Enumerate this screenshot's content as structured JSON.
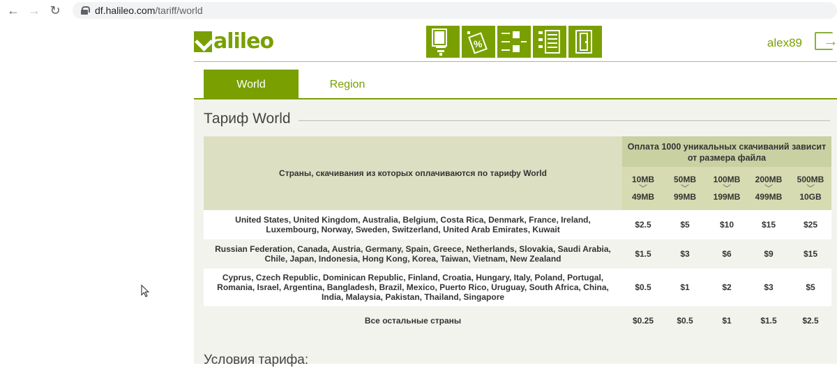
{
  "browser": {
    "url_host": "df.halileo.com",
    "url_path": "/tariff/world",
    "nav_icons": [
      "back-arrow-icon",
      "forward-arrow-icon",
      "reload-icon",
      "lock-icon"
    ]
  },
  "header": {
    "logo_text": "alileo",
    "logo_icon": "halileo-logo-icon",
    "username": "alex89",
    "tool_icons": [
      "document-download-icon",
      "percent-tag-icon",
      "flow-arrows-icon",
      "list-document-icon",
      "door-icon"
    ]
  },
  "tabs": [
    {
      "label": "World",
      "active": true
    },
    {
      "label": "Region",
      "active": false
    }
  ],
  "page_title": "Тариф World",
  "table": {
    "header_countries": "Страны, скачивания из которых оплачиваются по тарифу World",
    "header_payment": "Оплата 1000 уникальных скачиваний зависит от размера файла",
    "sizes": [
      {
        "from": "10MB",
        "to": "49MB"
      },
      {
        "from": "50MB",
        "to": "99MB"
      },
      {
        "from": "100MB",
        "to": "199MB"
      },
      {
        "from": "200MB",
        "to": "499MB"
      },
      {
        "from": "500MB",
        "to": "10GB"
      }
    ],
    "rows": [
      {
        "countries": "United States, United Kingdom, Australia, Belgium, Costa Rica, Denmark, France, Ireland, Luxembourg, Norway, Sweden, Switzerland, United Arab Emirates, Kuwait",
        "prices": [
          "$2.5",
          "$5",
          "$10",
          "$15",
          "$25"
        ]
      },
      {
        "countries": "Russian Federation, Canada, Austria, Germany, Spain, Greece, Netherlands, Slovakia, Saudi Arabia, Chile, Japan, Indonesia, Hong Kong, Korea, Taiwan, Vietnam, New Zealand",
        "prices": [
          "$1.5",
          "$3",
          "$6",
          "$9",
          "$15"
        ]
      },
      {
        "countries": "Cyprus, Czech Republic, Dominican Republic, Finland, Croatia, Hungary, Italy, Poland, Portugal, Romania, Israel, Argentina, Bangladesh, Brazil, Mexico, Puerto Rico, Uruguay, South Africa, China, India, Malaysia, Pakistan, Thailand, Singapore",
        "prices": [
          "$0.5",
          "$1",
          "$2",
          "$3",
          "$5"
        ]
      },
      {
        "countries": "Все остальные страны",
        "prices": [
          "$0.25",
          "$0.5",
          "$1",
          "$1.5",
          "$2.5"
        ]
      }
    ]
  },
  "next_section_title": "Условия тарифа:"
}
